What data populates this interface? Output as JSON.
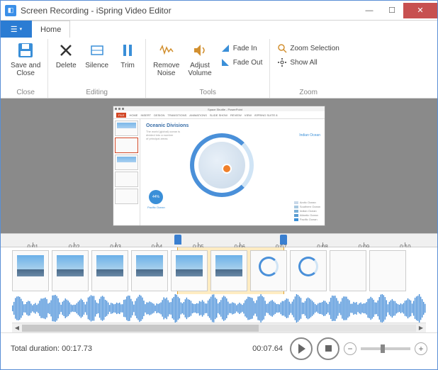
{
  "window": {
    "title": "Screen Recording - iSpring Video Editor",
    "app_icon": "◧"
  },
  "ribbon": {
    "file_tab": "☰",
    "tabs": [
      "Home"
    ],
    "groups": {
      "close": {
        "label": "Close",
        "save_close": "Save and\nClose"
      },
      "editing": {
        "label": "Editing",
        "delete": "Delete",
        "silence": "Silence",
        "trim": "Trim"
      },
      "tools": {
        "label": "Tools",
        "remove_noise": "Remove\nNoise",
        "adjust_volume": "Adjust\nVolume",
        "fade_in": "Fade In",
        "fade_out": "Fade Out"
      },
      "zoom": {
        "label": "Zoom",
        "zoom_selection": "Zoom Selection",
        "show_all": "Show All"
      }
    }
  },
  "preview": {
    "app_title": "Space Shuttle - PowerPoint",
    "pp_tabs": [
      "FILE",
      "HOME",
      "INSERT",
      "DESIGN",
      "TRANSITIONS",
      "ANIMATIONS",
      "SLIDE SHOW",
      "REVIEW",
      "VIEW",
      "iSPRING SUITE 8"
    ],
    "slide": {
      "title": "Oceanic Divisions",
      "subtitle": "The world (global) ocean is\ndivided into a number\nof principal areas",
      "badge": "44%",
      "badge_label": "Pacific Ocean",
      "side_title": "Indian Ocean",
      "legend": [
        "Arctic Ocean",
        "Southern Ocean",
        "Indian Ocean",
        "Atlantic Ocean",
        "Pacific Ocean"
      ]
    }
  },
  "ruler": {
    "ticks": [
      "0:01",
      "0:02",
      "0:03",
      "0:04",
      "0:05",
      "0:06",
      "0:07",
      "0:08",
      "0:09",
      "0:10"
    ]
  },
  "timeline": {
    "selection": {
      "start_pct": 40.5,
      "end_pct": 65
    },
    "cursor_pct": 65
  },
  "playback": {
    "total_duration_label": "Total duration:",
    "total_duration": "00:17.73",
    "current_time": "00:07.64"
  },
  "colors": {
    "accent": "#2b7cd3",
    "close": "#c75050",
    "wave": "#4a90d9"
  }
}
